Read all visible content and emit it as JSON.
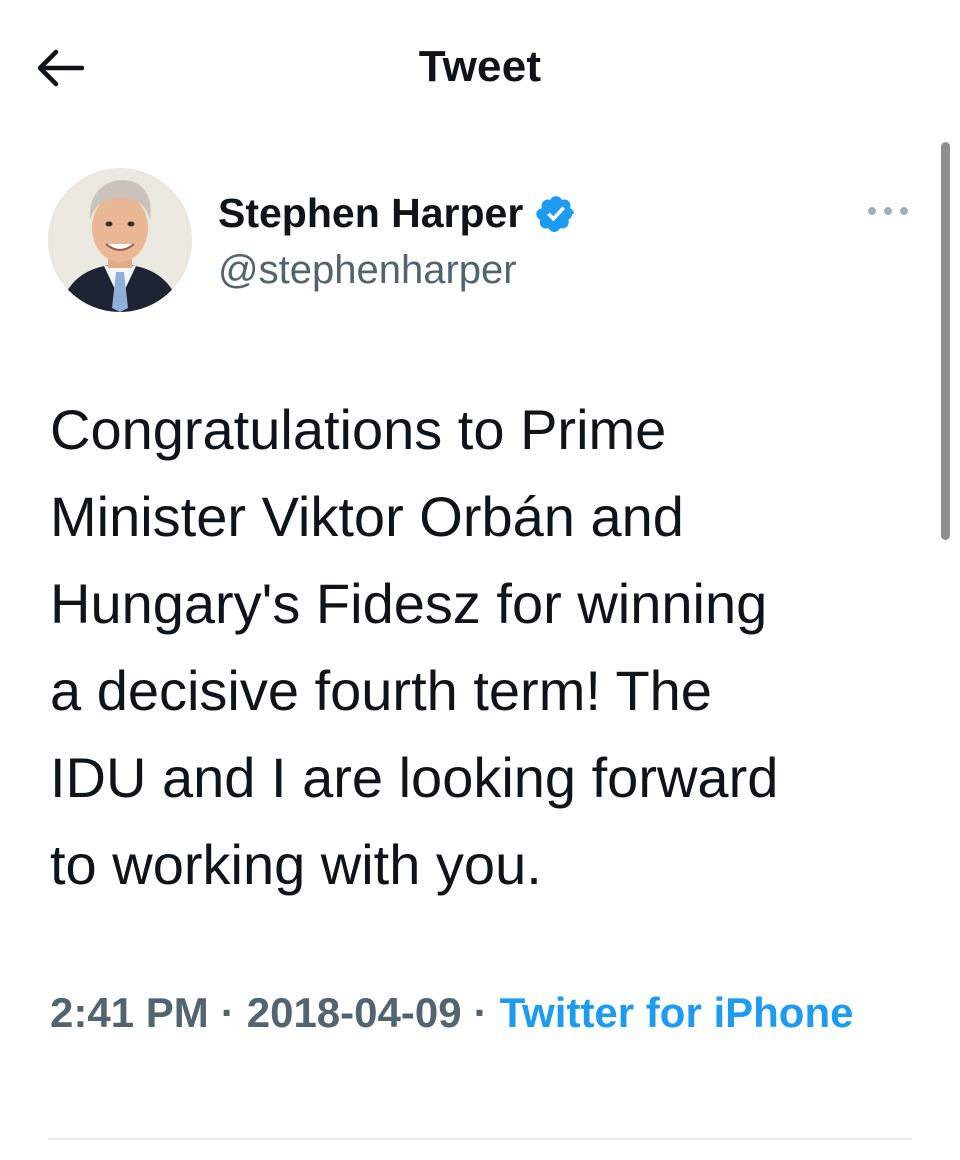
{
  "header": {
    "title": "Tweet",
    "back_icon": "arrow-left-icon"
  },
  "tweet": {
    "author": {
      "display_name": "Stephen Harper",
      "handle": "@stephenharper",
      "verified": true,
      "verified_color": "#1d9bf0",
      "avatar_icon": "profile-photo"
    },
    "more_icon": "more-horizontal-icon",
    "text": "Congratulations to Prime\nMinister Viktor Orbán and\nHungary's Fidesz for winning\na decisive fourth term! The\nIDU and I are looking forward\nto working with you.",
    "time": "2:41 PM",
    "date": "2018-04-09",
    "separator": "·",
    "source": "Twitter for iPhone",
    "source_color": "#1d9bf0"
  }
}
